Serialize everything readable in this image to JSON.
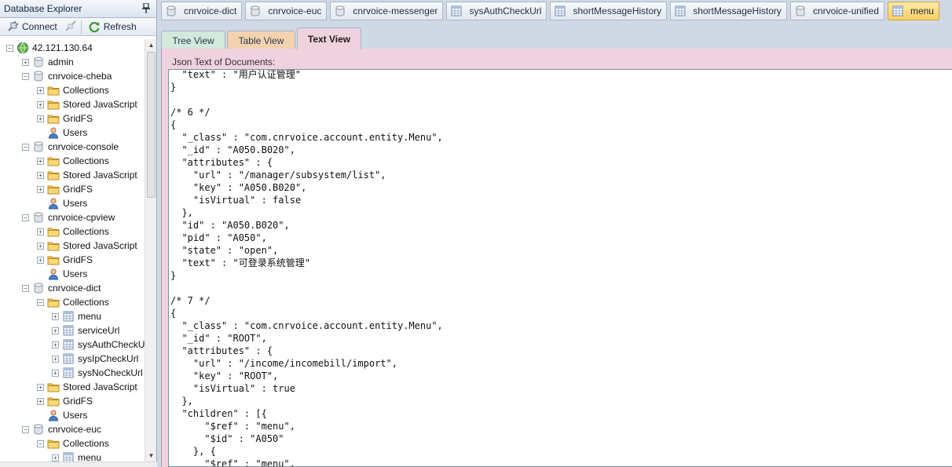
{
  "explorer": {
    "title": "Database Explorer",
    "connect_label": "Connect",
    "refresh_label": "Refresh"
  },
  "tree": [
    {
      "label": "42.121.130.64",
      "level": 0,
      "icon": "server-icon",
      "expander": "minus"
    },
    {
      "label": "admin",
      "level": 1,
      "icon": "database-icon",
      "expander": "plus"
    },
    {
      "label": "cnrvoice-cheba",
      "level": 1,
      "icon": "database-icon",
      "expander": "minus"
    },
    {
      "label": "Collections",
      "level": 2,
      "icon": "folder-icon",
      "expander": "plus"
    },
    {
      "label": "Stored JavaScript",
      "level": 2,
      "icon": "folder-icon",
      "expander": "plus"
    },
    {
      "label": "GridFS",
      "level": 2,
      "icon": "folder-icon",
      "expander": "plus"
    },
    {
      "label": "Users",
      "level": 2,
      "icon": "user-icon",
      "expander": "none"
    },
    {
      "label": "cnrvoice-console",
      "level": 1,
      "icon": "database-icon",
      "expander": "minus"
    },
    {
      "label": "Collections",
      "level": 2,
      "icon": "folder-icon",
      "expander": "plus"
    },
    {
      "label": "Stored JavaScript",
      "level": 2,
      "icon": "folder-icon",
      "expander": "plus"
    },
    {
      "label": "GridFS",
      "level": 2,
      "icon": "folder-icon",
      "expander": "plus"
    },
    {
      "label": "Users",
      "level": 2,
      "icon": "user-icon",
      "expander": "none"
    },
    {
      "label": "cnrvoice-cpview",
      "level": 1,
      "icon": "database-icon",
      "expander": "minus"
    },
    {
      "label": "Collections",
      "level": 2,
      "icon": "folder-icon",
      "expander": "plus"
    },
    {
      "label": "Stored JavaScript",
      "level": 2,
      "icon": "folder-icon",
      "expander": "plus"
    },
    {
      "label": "GridFS",
      "level": 2,
      "icon": "folder-icon",
      "expander": "plus"
    },
    {
      "label": "Users",
      "level": 2,
      "icon": "user-icon",
      "expander": "none"
    },
    {
      "label": "cnrvoice-dict",
      "level": 1,
      "icon": "database-icon",
      "expander": "minus"
    },
    {
      "label": "Collections",
      "level": 2,
      "icon": "folder-icon",
      "expander": "minus"
    },
    {
      "label": "menu",
      "level": 3,
      "icon": "table-icon",
      "expander": "plus"
    },
    {
      "label": "serviceUrl",
      "level": 3,
      "icon": "table-icon",
      "expander": "plus"
    },
    {
      "label": "sysAuthCheckU",
      "level": 3,
      "icon": "table-icon",
      "expander": "plus"
    },
    {
      "label": "sysIpCheckUrl",
      "level": 3,
      "icon": "table-icon",
      "expander": "plus"
    },
    {
      "label": "sysNoCheckUrl",
      "level": 3,
      "icon": "table-icon",
      "expander": "plus"
    },
    {
      "label": "Stored JavaScript",
      "level": 2,
      "icon": "folder-icon",
      "expander": "plus"
    },
    {
      "label": "GridFS",
      "level": 2,
      "icon": "folder-icon",
      "expander": "plus"
    },
    {
      "label": "Users",
      "level": 2,
      "icon": "user-icon",
      "expander": "none"
    },
    {
      "label": "cnrvoice-euc",
      "level": 1,
      "icon": "database-icon",
      "expander": "minus"
    },
    {
      "label": "Collections",
      "level": 2,
      "icon": "folder-icon",
      "expander": "minus"
    },
    {
      "label": "menu",
      "level": 3,
      "icon": "table-icon",
      "expander": "plus"
    }
  ],
  "doc_tabs": [
    {
      "label": "cnrvoice-dict",
      "icon": "database-icon",
      "active": false
    },
    {
      "label": "cnrvoice-euc",
      "icon": "database-icon",
      "active": false
    },
    {
      "label": "cnrvoice-messenger",
      "icon": "database-icon",
      "active": false
    },
    {
      "label": "sysAuthCheckUrl",
      "icon": "table-icon",
      "active": false
    },
    {
      "label": "shortMessageHistory",
      "icon": "table-icon",
      "active": false
    },
    {
      "label": "shortMessageHistory",
      "icon": "table-icon",
      "active": false
    },
    {
      "label": "cnrvoice-unified",
      "icon": "database-icon",
      "active": false
    },
    {
      "label": "menu",
      "icon": "table-icon",
      "active": true
    }
  ],
  "view_tabs": [
    {
      "label": "Tree View",
      "active": false,
      "color": "#d4e8dc"
    },
    {
      "label": "Table View",
      "active": false,
      "color": "#f4d2b0"
    },
    {
      "label": "Text View",
      "active": true,
      "color": "#eed3de"
    }
  ],
  "json_label": "Json Text of Documents:",
  "json_lines": [
    "  \"text\" : \"用户认证管理\"",
    "}",
    "",
    "/* 6 */",
    "{",
    "  \"_class\" : \"com.cnrvoice.account.entity.Menu\",",
    "  \"_id\" : \"A050.B020\",",
    "  \"attributes\" : {",
    "    \"url\" : \"/manager/subsystem/list\",",
    "    \"key\" : \"A050.B020\",",
    "    \"isVirtual\" : false",
    "  },",
    "  \"id\" : \"A050.B020\",",
    "  \"pid\" : \"A050\",",
    "  \"state\" : \"open\",",
    "  \"text\" : \"可登录系统管理\"",
    "}",
    "",
    "/* 7 */",
    "{",
    "  \"_class\" : \"com.cnrvoice.account.entity.Menu\",",
    "  \"_id\" : \"ROOT\",",
    "  \"attributes\" : {",
    "    \"url\" : \"/income/incomebill/import\",",
    "    \"key\" : \"ROOT\",",
    "    \"isVirtual\" : true",
    "  },",
    "  \"children\" : [{",
    "      \"$ref\" : \"menu\",",
    "      \"$id\" : \"A050\"",
    "    }, {",
    "      \"$ref\" : \"menu\","
  ]
}
